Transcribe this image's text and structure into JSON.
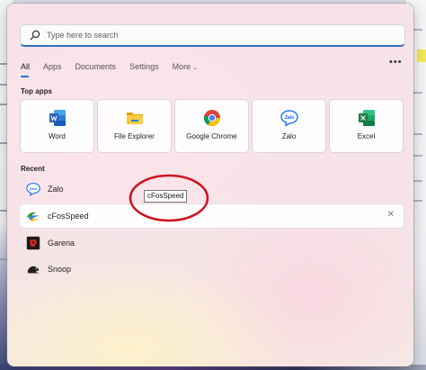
{
  "search": {
    "placeholder": "Type here to search"
  },
  "tabs": [
    {
      "label": "All"
    },
    {
      "label": "Apps"
    },
    {
      "label": "Documents"
    },
    {
      "label": "Settings"
    },
    {
      "label": "More"
    }
  ],
  "top_apps": {
    "title": "Top apps",
    "items": [
      {
        "label": "Word",
        "icon": "word-icon"
      },
      {
        "label": "File Explorer",
        "icon": "file-explorer-icon"
      },
      {
        "label": "Google Chrome",
        "icon": "chrome-icon"
      },
      {
        "label": "Zalo",
        "icon": "zalo-icon"
      },
      {
        "label": "Excel",
        "icon": "excel-icon"
      }
    ]
  },
  "recent": {
    "title": "Recent",
    "items": [
      {
        "label": "Zalo",
        "icon": "zalo-icon"
      },
      {
        "label": "cFosSpeed",
        "icon": "cfosspeed-icon"
      },
      {
        "label": "Garena",
        "icon": "garena-icon"
      },
      {
        "label": "Snoop",
        "icon": "snoop-icon"
      }
    ]
  },
  "tooltip": {
    "text": "cFosSpeed"
  },
  "icon_text": {
    "zalo": "Zalo"
  },
  "colors": {
    "accent": "#2f6fbd",
    "annotation": "#d0121b",
    "word": "#2b5cb8",
    "excel": "#1f7a45",
    "zalo": "#0a68ff"
  }
}
